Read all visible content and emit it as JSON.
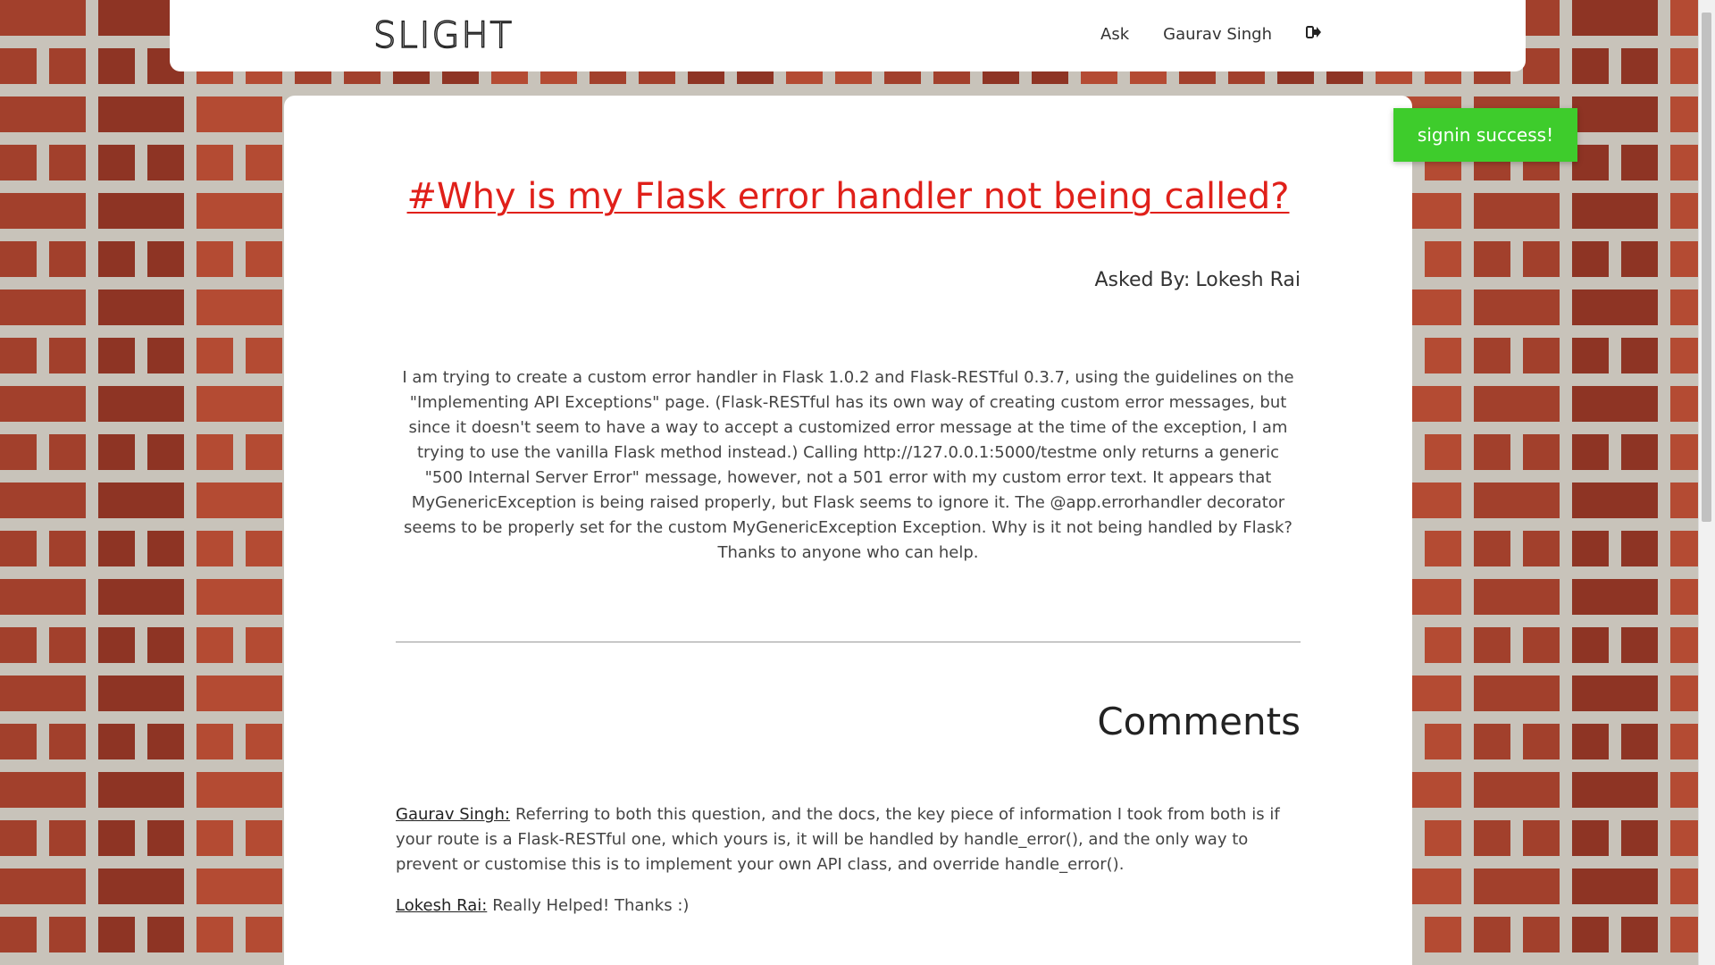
{
  "navbar": {
    "brand": "SLIGHT",
    "ask_label": "Ask",
    "user_name": "Gaurav Singh",
    "logout_icon": "sign-out-icon"
  },
  "toast": {
    "message": "signin success!",
    "color": "#3ecc2c"
  },
  "question": {
    "title": "#Why is my Flask error handler not being called?",
    "asked_by_label": "Asked By:",
    "asked_by_name": "Lokesh Rai",
    "body": "I am trying to create a custom error handler in Flask 1.0.2 and Flask-RESTful 0.3.7, using the guidelines on the \"Implementing API Exceptions\" page. (Flask-RESTful has its own way of creating custom error messages, but since it doesn't seem to have a way to accept a customized error message at the time of the exception, I am trying to use the vanilla Flask method instead.) Calling http://127.0.0.1:5000/testme only returns a generic \"500 Internal Server Error\" message, however, not a 501 error with my custom error text. It appears that MyGenericException is being raised properly, but Flask seems to ignore it. The @app.errorhandler decorator seems to be properly set for the custom MyGenericException Exception. Why is it not being handled by Flask? Thanks to anyone who can help.",
    "title_color": "#e0201a"
  },
  "comments": {
    "heading": "Comments",
    "items": [
      {
        "author": "Gaurav Singh:",
        "text": "Referring to both this question, and the docs, the key piece of information I took from both is if your route is a Flask-RESTful one, which yours is, it will be handled by handle_error(), and the only way to prevent or customise this is to implement your own API class, and override handle_error()."
      },
      {
        "author": "Lokesh Rai:",
        "text": "Really Helped! Thanks :)"
      }
    ]
  }
}
